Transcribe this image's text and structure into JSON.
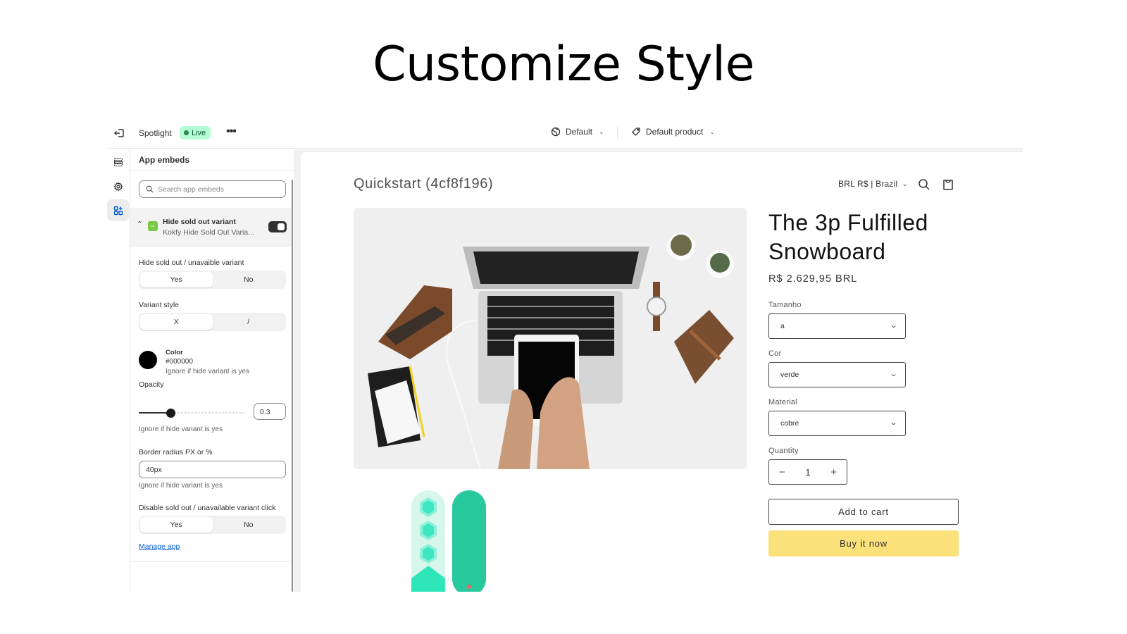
{
  "hero": {
    "title": "Customize Style"
  },
  "topbar": {
    "theme_name": "Spotlight",
    "status_badge": "Live",
    "more_label": "•••",
    "locale_select": "Default",
    "product_select": "Default product"
  },
  "rail": {
    "items": [
      {
        "name": "sections",
        "icon": "sections-icon",
        "active": false
      },
      {
        "name": "theme-settings",
        "icon": "gear-icon",
        "active": false
      },
      {
        "name": "app-embeds",
        "icon": "apps-icon",
        "active": true
      }
    ]
  },
  "panel": {
    "title": "App embeds",
    "search_placeholder": "Search app embeds",
    "embed": {
      "title": "Hide sold out variant",
      "subtitle": "Kokfy Hide Sold Out Varia...",
      "enabled": true,
      "logo_text": "kfy"
    },
    "settings": {
      "hide_label": "Hide sold out / unavaible variant",
      "hide_options": [
        "Yes",
        "No"
      ],
      "hide_selected": "Yes",
      "variant_style_label": "Variant style",
      "variant_style_options": [
        "X",
        "/"
      ],
      "variant_style_selected": "X",
      "color_label": "Color",
      "color_value": "#000000",
      "color_help": "Ignore if hide variant is yes",
      "opacity_label": "Opacity",
      "opacity_value": "0.3",
      "opacity_fraction": 0.3,
      "opacity_help": "Ignore if hide variant is yes",
      "radius_label": "Border radius PX or %",
      "radius_value": "40px",
      "radius_help": "Ignore if hide variant is yes",
      "disable_click_label": "Disable sold out / unavailable variant click",
      "disable_click_options": [
        "Yes",
        "No"
      ],
      "disable_click_selected": "Yes"
    },
    "manage_link": "Manage app"
  },
  "preview": {
    "store_name": "Quickstart (4cf8f196)",
    "locale": "BRL R$ | Brazil",
    "product": {
      "title": "The 3p Fulfilled Snowboard",
      "price": "R$ 2.629,95 BRL",
      "options": [
        {
          "label": "Tamanho",
          "value": "a"
        },
        {
          "label": "Cor",
          "value": "verde"
        },
        {
          "label": "Material",
          "value": "cobre"
        }
      ],
      "quantity_label": "Quantity",
      "quantity": "1",
      "add_to_cart": "Add to cart",
      "buy_now": "Buy it now"
    }
  },
  "colors": {
    "live_badge_bg": "#b4fed2",
    "accent_link": "#005bd3",
    "buy_button": "#fbe17a",
    "embed_logo": "#7ac943"
  }
}
